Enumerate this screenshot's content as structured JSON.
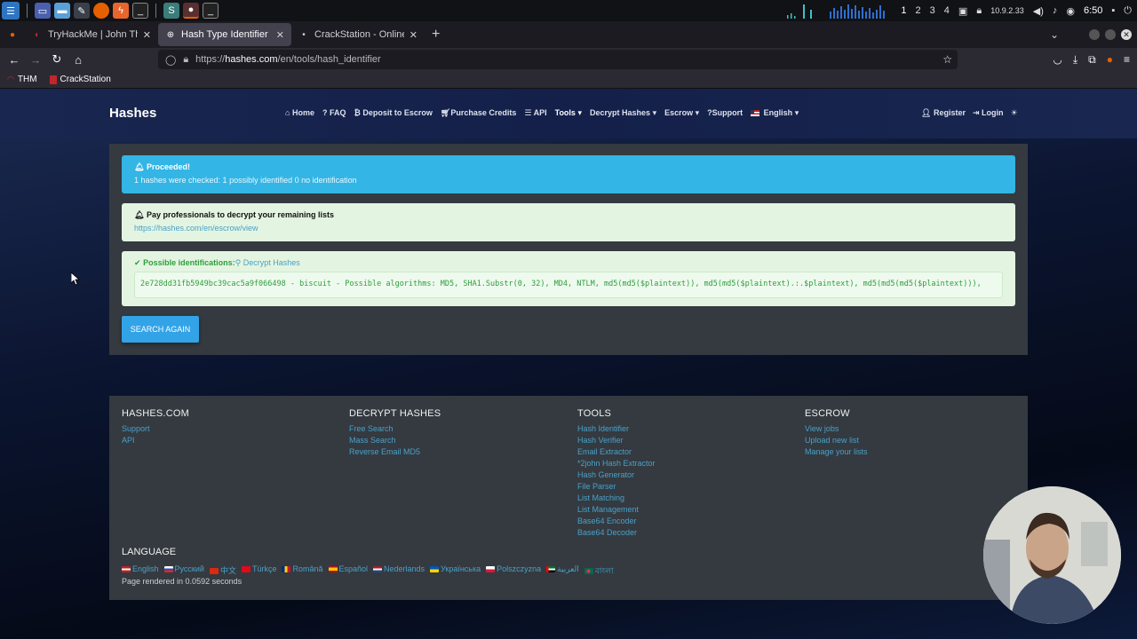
{
  "taskbar": {
    "workspaces": [
      "1",
      "2",
      "3",
      "4"
    ],
    "ip": "10.9.2.33",
    "clock": "6:50"
  },
  "tabs": [
    {
      "label": "TryHackMe | John The Ri",
      "active": false
    },
    {
      "label": "Hash Type Identifier - Ide",
      "active": true
    },
    {
      "label": "CrackStation - Online Pas",
      "active": false
    }
  ],
  "url": {
    "prefix": "https://",
    "domain": "hashes.com",
    "path": "/en/tools/hash_identifier"
  },
  "bookmarks": [
    "THM",
    "CrackStation"
  ],
  "site": {
    "brand": "Hashes",
    "nav": {
      "home": "Home",
      "faq": "FAQ",
      "deposit": "Deposit to Escrow",
      "purchase": "Purchase Credits",
      "api": "API",
      "tools": "Tools",
      "decrypt": "Decrypt Hashes",
      "escrow": "Escrow",
      "support": "?Support",
      "language": "English"
    },
    "auth": {
      "register": "Register",
      "login": "Login"
    }
  },
  "alerts": {
    "info_title": "Proceeded!",
    "info_body": "1 hashes were checked: 1 possibly identified 0 no identification",
    "escrow_title": "Pay professionals to decrypt your remaining lists",
    "escrow_link": "https://hashes.com/en/escrow/view",
    "result_title": "Possible identifications:",
    "result_link": "Decrypt Hashes",
    "result_text": "2e728dd31fb5949bc39cac5a9f066498 - biscuit - Possible algorithms: MD5, SHA1.Substr(0, 32), MD4, NTLM, md5(md5($plaintext)), md5(md5($plaintext).:.$plaintext), md5(md5(md5($plaintext))),"
  },
  "search_again": "SEARCH AGAIN",
  "footer": {
    "col1": {
      "title": "HASHES.COM",
      "links": [
        "Support",
        "API"
      ]
    },
    "col2": {
      "title": "DECRYPT HASHES",
      "links": [
        "Free Search",
        "Mass Search",
        "Reverse Email MD5"
      ]
    },
    "col3": {
      "title": "TOOLS",
      "links": [
        "Hash Identifier",
        "Hash Verifier",
        "Email Extractor",
        "*2john Hash Extractor",
        "Hash Generator",
        "File Parser",
        "List Matching",
        "List Management",
        "Base64 Encoder",
        "Base64 Decoder"
      ]
    },
    "col4": {
      "title": "ESCROW",
      "links": [
        "View jobs",
        "Upload new list",
        "Manage your lists"
      ]
    },
    "language_title": "LANGUAGE",
    "languages": [
      "English",
      "Русский",
      "中文",
      "Türkçe",
      "Română",
      "Español",
      "Nederlands",
      "Українська",
      "Polszczyzna",
      "العربية",
      "বাংলা"
    ],
    "rendered": "Page rendered in 0.0592 seconds"
  },
  "colors": {
    "info": "#33b5e5",
    "success_bg": "#e3f5e1",
    "success_text": "#2e9e3e",
    "link": "#4aa0c8",
    "panel": "#343a40"
  }
}
